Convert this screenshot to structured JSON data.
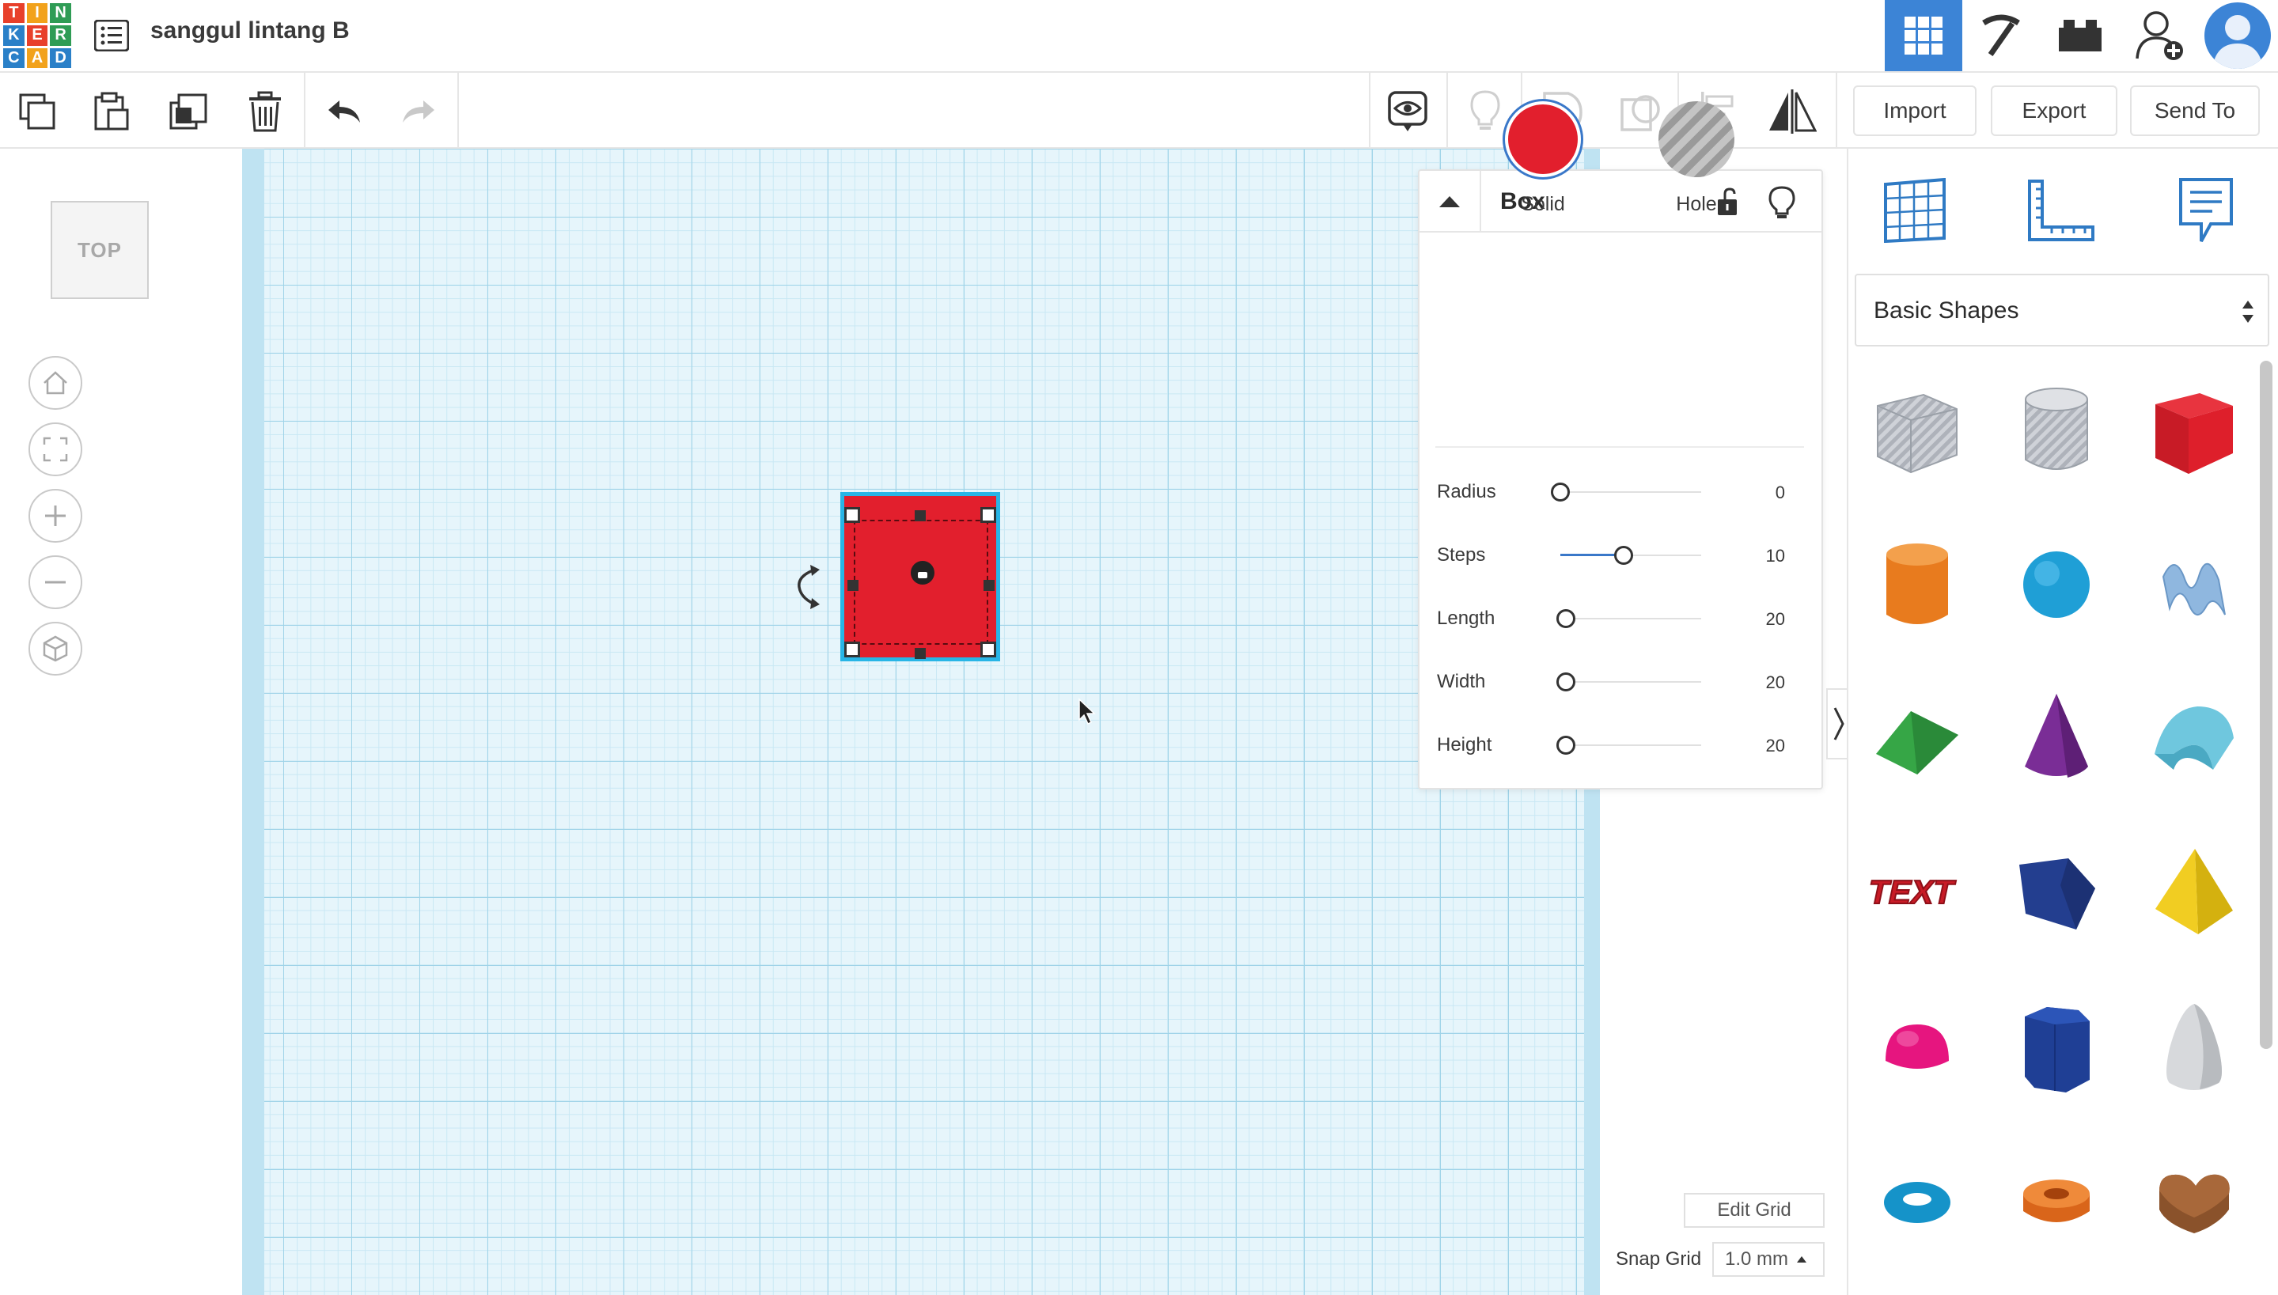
{
  "app": {
    "logo_letters": [
      "T",
      "I",
      "N",
      "K",
      "E",
      "R",
      "C",
      "A",
      "D"
    ],
    "design_title": "sanggul lintang B"
  },
  "header": {
    "buttons": [
      "3d-design-view",
      "circuits",
      "codeblocks",
      "invite-user",
      "profile"
    ],
    "active_view": "3d-design-view",
    "accent_color": "#3c84d6"
  },
  "toolbar": {
    "edit_icons": [
      "copy-icon",
      "paste-icon",
      "duplicate-icon",
      "trash-icon",
      "undo-icon",
      "redo-icon"
    ],
    "view_icons": [
      "notes-eye-icon",
      "bulb-icon",
      "group-icon",
      "ungroup-icon",
      "align-icon",
      "mirror-icon"
    ],
    "import_label": "Import",
    "export_label": "Export",
    "send_label": "Send To"
  },
  "view": {
    "cube_label": "TOP",
    "nav_icons": [
      "home-icon",
      "fit-icon",
      "zoom-in-icon",
      "zoom-out-icon",
      "perspective-icon"
    ]
  },
  "inspector": {
    "title": "Box",
    "materials": {
      "solid": "Solid",
      "hole": "Hole"
    },
    "solid_color": "#e21f2d",
    "selected_material": "Solid",
    "props": [
      {
        "label": "Radius",
        "value": "0",
        "level": 0
      },
      {
        "label": "Steps",
        "value": "10",
        "level": 0.45
      },
      {
        "label": "Length",
        "value": "20",
        "level": 0.04
      },
      {
        "label": "Width",
        "value": "20",
        "level": 0.04
      },
      {
        "label": "Height",
        "value": "20",
        "level": 0.04
      }
    ]
  },
  "right_panel": {
    "tools": [
      "workplane-icon",
      "ruler-icon",
      "notes-icon"
    ],
    "category": "Basic Shapes",
    "shapes": [
      "box-hole",
      "cylinder-hole",
      "box",
      "cylinder",
      "sphere",
      "scribble",
      "roof",
      "cone",
      "round-roof",
      "text",
      "wedge",
      "pyramid",
      "half-sphere",
      "polygon",
      "paraboloid",
      "torus",
      "tube",
      "heart"
    ],
    "text_shape_label": "TEXT"
  },
  "grid": {
    "edit_label": "Edit Grid",
    "snap_label": "Snap Grid",
    "snap_value": "1.0 mm"
  }
}
